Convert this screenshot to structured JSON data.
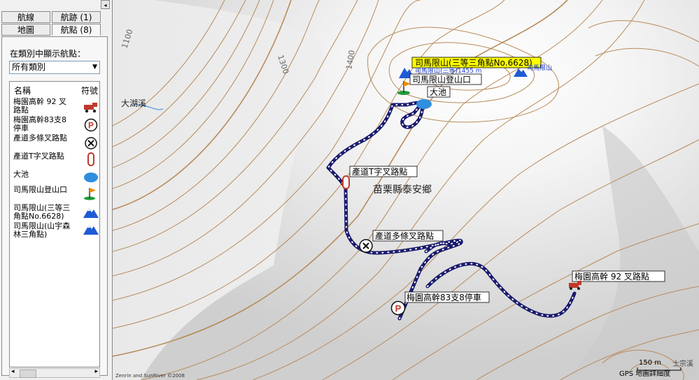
{
  "panel": {
    "tabs": [
      {
        "label": "航線"
      },
      {
        "label": "航跡 (1)"
      },
      {
        "label": "地圖"
      },
      {
        "label": "航點 (8)"
      }
    ],
    "collapse_glyph": "◂",
    "filter_label": "在類別中顯示航點：",
    "category_selected": "所有類別",
    "columns": {
      "name": "名稱",
      "symbol": "符號"
    },
    "waypoints": [
      {
        "name": "梅園高幹 92 叉路點",
        "symbol": "truck-icon"
      },
      {
        "name": "梅園高幹83支8停車",
        "symbol": "parking-icon"
      },
      {
        "name": "產道多條叉路點",
        "symbol": "cross-circle-icon"
      },
      {
        "name": "產道T字叉路點",
        "symbol": "red-capsule-icon"
      },
      {
        "name": "大池",
        "symbol": "pond-icon"
      },
      {
        "name": "司馬限山登山口",
        "symbol": "trailhead-flag-icon"
      },
      {
        "name": "司馬限山(三等三角點No.6628)",
        "symbol": "summit-icon"
      },
      {
        "name": "司馬限山(山宇森林三角點)",
        "symbol": "summit-icon"
      }
    ]
  },
  "map": {
    "contour_labels": [
      "1100",
      "1300",
      "1400"
    ],
    "place_labels": {
      "stream": "大湖溪",
      "district": "苗栗縣泰安鄉"
    },
    "summit_highlight": "司馬限山(三等三角點No.6628)",
    "summit_sub_label": "司馬限山(三等)1455 m",
    "summit2_label": "司馬限山",
    "waypoint_labels": {
      "trailhead": "司馬限山登山口",
      "pond": "大池",
      "t_junction": "產道T字叉路點",
      "multi_junction": "產道多條叉路點",
      "parking": "梅園高幹83支8停車",
      "junction92": "梅園高幹 92 叉路點"
    },
    "scale_label": "150 m",
    "copyright": "Zenrin and SunRiver ©2008",
    "detail_note": "GPS 地圖詳細度",
    "corner_place": "士宗溪",
    "colors": {
      "track": "#1a1a6e",
      "summit_bg": "#ffff00",
      "water": "#4aa0e8"
    }
  }
}
